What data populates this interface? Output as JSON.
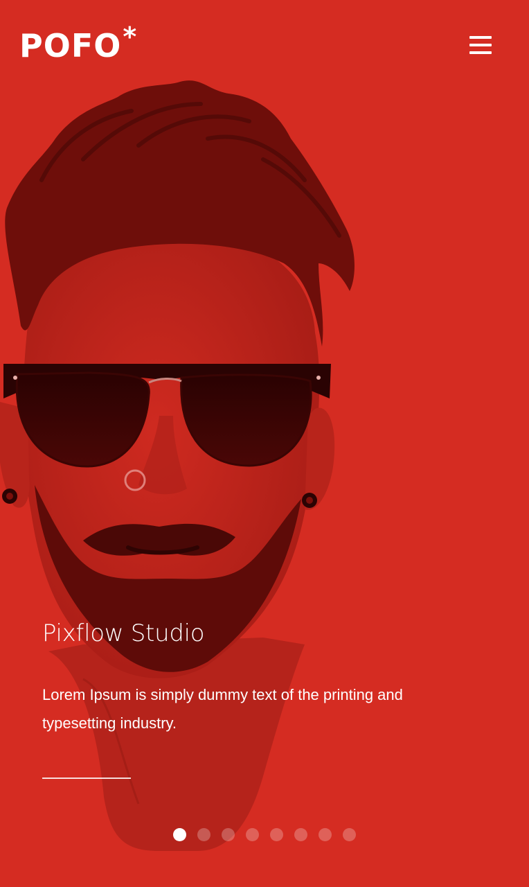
{
  "theme": {
    "background": "#d52c22",
    "accent": "#ffffff"
  },
  "header": {
    "logo_text": "POFO",
    "logo_mark": "*",
    "menu_icon": "hamburger-menu-icon"
  },
  "slide": {
    "title": "Pixflow Studio",
    "description": "Lorem Ipsum is simply dummy text of the printing and typesetting industry."
  },
  "pagination": {
    "total": 8,
    "active_index": 0
  }
}
